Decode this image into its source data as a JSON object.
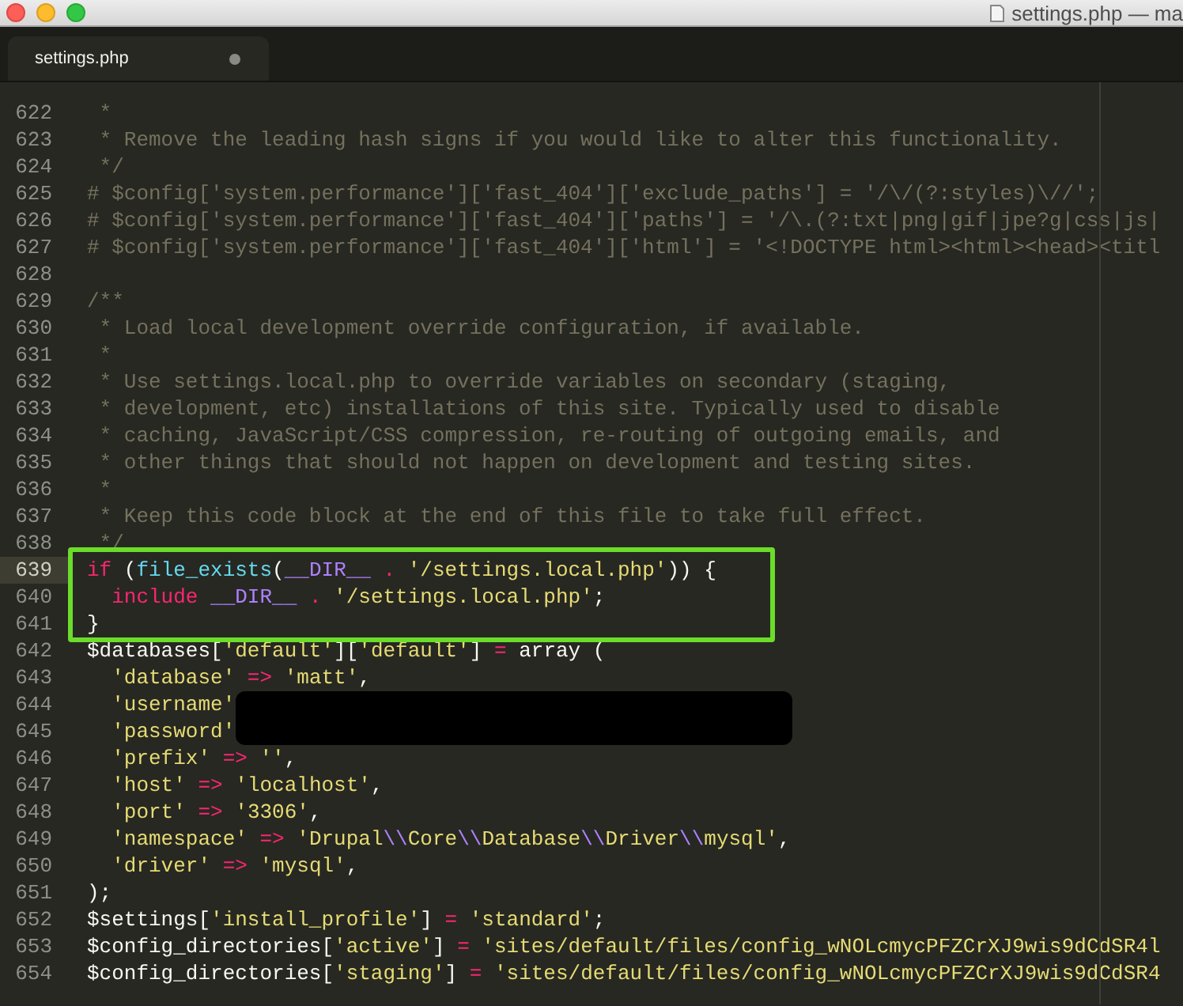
{
  "window": {
    "title": "settings.php — ma"
  },
  "tabs": [
    {
      "label": "settings.php",
      "selected": true,
      "modified": true
    }
  ],
  "lines": [
    {
      "number": "622",
      "current": false,
      "boxed": false,
      "redacted": false,
      "tokens": [
        {
          "kind": "comment",
          "text": " *"
        }
      ]
    },
    {
      "number": "623",
      "current": false,
      "boxed": false,
      "redacted": false,
      "tokens": [
        {
          "kind": "comment",
          "text": " * Remove the leading hash signs if you would like to alter this functionality."
        }
      ]
    },
    {
      "number": "624",
      "current": false,
      "boxed": false,
      "redacted": false,
      "tokens": [
        {
          "kind": "comment",
          "text": " */"
        }
      ]
    },
    {
      "number": "625",
      "current": false,
      "boxed": false,
      "redacted": false,
      "tokens": [
        {
          "kind": "comment",
          "text": "# $config['system.performance']['fast_404']['exclude_paths'] = '/\\/(?:styles)\\//';"
        }
      ]
    },
    {
      "number": "626",
      "current": false,
      "boxed": false,
      "redacted": false,
      "tokens": [
        {
          "kind": "comment",
          "text": "# $config['system.performance']['fast_404']['paths'] = '/\\.(?:txt|png|gif|jpe?g|css|js|"
        }
      ]
    },
    {
      "number": "627",
      "current": false,
      "boxed": false,
      "redacted": false,
      "tokens": [
        {
          "kind": "comment",
          "text": "# $config['system.performance']['fast_404']['html'] = '<!DOCTYPE html><html><head><titl"
        }
      ]
    },
    {
      "number": "628",
      "current": false,
      "boxed": false,
      "redacted": false
    },
    {
      "number": "629",
      "current": false,
      "boxed": false,
      "redacted": false,
      "tokens": [
        {
          "kind": "comment",
          "text": "/**"
        }
      ]
    },
    {
      "number": "630",
      "current": false,
      "boxed": false,
      "redacted": false,
      "tokens": [
        {
          "kind": "comment",
          "text": " * Load local development override configuration, if available."
        }
      ]
    },
    {
      "number": "631",
      "current": false,
      "boxed": false,
      "redacted": false,
      "tokens": [
        {
          "kind": "comment",
          "text": " *"
        }
      ]
    },
    {
      "number": "632",
      "current": false,
      "boxed": false,
      "redacted": false,
      "tokens": [
        {
          "kind": "comment",
          "text": " * Use settings.local.php to override variables on secondary (staging,"
        }
      ]
    },
    {
      "number": "633",
      "current": false,
      "boxed": false,
      "redacted": false,
      "tokens": [
        {
          "kind": "comment",
          "text": " * development, etc) installations of this site. Typically used to disable"
        }
      ]
    },
    {
      "number": "634",
      "current": false,
      "boxed": false,
      "redacted": false,
      "tokens": [
        {
          "kind": "comment",
          "text": " * caching, JavaScript/CSS compression, re-routing of outgoing emails, and"
        }
      ]
    },
    {
      "number": "635",
      "current": false,
      "boxed": false,
      "redacted": false,
      "tokens": [
        {
          "kind": "comment",
          "text": " * other things that should not happen on development and testing sites."
        }
      ]
    },
    {
      "number": "636",
      "current": false,
      "boxed": false,
      "redacted": false,
      "tokens": [
        {
          "kind": "comment",
          "text": " *"
        }
      ]
    },
    {
      "number": "637",
      "current": false,
      "boxed": false,
      "redacted": false,
      "tokens": [
        {
          "kind": "comment",
          "text": " * Keep this code block at the end of this file to take full effect."
        }
      ]
    },
    {
      "number": "638",
      "current": false,
      "boxed": false,
      "redacted": false,
      "tokens": [
        {
          "kind": "comment",
          "text": " */"
        }
      ]
    },
    {
      "number": "639",
      "current": true,
      "boxed": true,
      "redacted": false,
      "tokens": [
        {
          "kind": "keyword",
          "text": "if"
        },
        {
          "kind": "plain",
          "text": " ("
        },
        {
          "kind": "function",
          "text": "file_exists"
        },
        {
          "kind": "plain",
          "text": "("
        },
        {
          "kind": "constant",
          "text": "__DIR__"
        },
        {
          "kind": "operator",
          "text": " . "
        },
        {
          "kind": "string",
          "text": "'/settings.local.php'"
        },
        {
          "kind": "plain",
          "text": ")) {"
        }
      ]
    },
    {
      "number": "640",
      "current": false,
      "boxed": true,
      "redacted": false,
      "tokens": [
        {
          "kind": "keyword",
          "text": "  include"
        },
        {
          "kind": "constant",
          "text": " __DIR__"
        },
        {
          "kind": "operator",
          "text": " . "
        },
        {
          "kind": "string",
          "text": "'/settings.local.php'"
        },
        {
          "kind": "plain",
          "text": ";"
        }
      ]
    },
    {
      "number": "641",
      "current": false,
      "boxed": true,
      "redacted": false,
      "tokens": [
        {
          "kind": "plain",
          "text": "}"
        }
      ]
    },
    {
      "number": "642",
      "current": false,
      "boxed": false,
      "redacted": false,
      "tokens": [
        {
          "kind": "plain",
          "text": "$databases["
        },
        {
          "kind": "string",
          "text": "'default'"
        },
        {
          "kind": "plain",
          "text": "]["
        },
        {
          "kind": "string",
          "text": "'default'"
        },
        {
          "kind": "plain",
          "text": "] "
        },
        {
          "kind": "operator",
          "text": "="
        },
        {
          "kind": "plain",
          "text": " array ("
        }
      ]
    },
    {
      "number": "643",
      "current": false,
      "boxed": false,
      "redacted": false,
      "tokens": [
        {
          "kind": "string",
          "text": "  'database'"
        },
        {
          "kind": "operator",
          "text": " => "
        },
        {
          "kind": "string",
          "text": "'matt'"
        },
        {
          "kind": "plain",
          "text": ","
        }
      ]
    },
    {
      "number": "644",
      "current": false,
      "boxed": false,
      "redacted": true,
      "tokens": [
        {
          "kind": "string",
          "text": "  'username'"
        }
      ]
    },
    {
      "number": "645",
      "current": false,
      "boxed": false,
      "redacted": true,
      "tokens": [
        {
          "kind": "string",
          "text": "  'password'"
        }
      ]
    },
    {
      "number": "646",
      "current": false,
      "boxed": false,
      "redacted": false,
      "tokens": [
        {
          "kind": "string",
          "text": "  'prefix'"
        },
        {
          "kind": "operator",
          "text": " => "
        },
        {
          "kind": "string",
          "text": "''"
        },
        {
          "kind": "plain",
          "text": ","
        }
      ]
    },
    {
      "number": "647",
      "current": false,
      "boxed": false,
      "redacted": false,
      "tokens": [
        {
          "kind": "string",
          "text": "  'host'"
        },
        {
          "kind": "operator",
          "text": " => "
        },
        {
          "kind": "string",
          "text": "'localhost'"
        },
        {
          "kind": "plain",
          "text": ","
        }
      ]
    },
    {
      "number": "648",
      "current": false,
      "boxed": false,
      "redacted": false,
      "tokens": [
        {
          "kind": "string",
          "text": "  'port'"
        },
        {
          "kind": "operator",
          "text": " => "
        },
        {
          "kind": "string",
          "text": "'3306'"
        },
        {
          "kind": "plain",
          "text": ","
        }
      ]
    },
    {
      "number": "649",
      "current": false,
      "boxed": false,
      "redacted": false,
      "tokens": [
        {
          "kind": "string",
          "text": "  'namespace'"
        },
        {
          "kind": "operator",
          "text": " => "
        },
        {
          "kind": "string",
          "text": "'Drupal"
        },
        {
          "kind": "escape",
          "text": "\\\\"
        },
        {
          "kind": "string",
          "text": "Core"
        },
        {
          "kind": "escape",
          "text": "\\\\"
        },
        {
          "kind": "string",
          "text": "Database"
        },
        {
          "kind": "escape",
          "text": "\\\\"
        },
        {
          "kind": "string",
          "text": "Driver"
        },
        {
          "kind": "escape",
          "text": "\\\\"
        },
        {
          "kind": "string",
          "text": "mysql'"
        },
        {
          "kind": "plain",
          "text": ","
        }
      ]
    },
    {
      "number": "650",
      "current": false,
      "boxed": false,
      "redacted": false,
      "tokens": [
        {
          "kind": "string",
          "text": "  'driver'"
        },
        {
          "kind": "operator",
          "text": " => "
        },
        {
          "kind": "string",
          "text": "'mysql'"
        },
        {
          "kind": "plain",
          "text": ","
        }
      ]
    },
    {
      "number": "651",
      "current": false,
      "boxed": false,
      "redacted": false,
      "tokens": [
        {
          "kind": "plain",
          "text": ");"
        }
      ]
    },
    {
      "number": "652",
      "current": false,
      "boxed": false,
      "redacted": false,
      "tokens": [
        {
          "kind": "plain",
          "text": "$settings["
        },
        {
          "kind": "string",
          "text": "'install_profile'"
        },
        {
          "kind": "plain",
          "text": "]"
        },
        {
          "kind": "operator",
          "text": " = "
        },
        {
          "kind": "string",
          "text": "'standard'"
        },
        {
          "kind": "plain",
          "text": ";"
        }
      ]
    },
    {
      "number": "653",
      "current": false,
      "boxed": false,
      "redacted": false,
      "tokens": [
        {
          "kind": "plain",
          "text": "$config_directories["
        },
        {
          "kind": "string",
          "text": "'active'"
        },
        {
          "kind": "plain",
          "text": "] "
        },
        {
          "kind": "operator",
          "text": "="
        },
        {
          "kind": "string",
          "text": " 'sites/default/files/config_wNOLcmycPFZCrXJ9wis9dCdSR4l"
        }
      ]
    },
    {
      "number": "654",
      "current": false,
      "boxed": false,
      "redacted": false,
      "tokens": [
        {
          "kind": "plain",
          "text": "$config_directories["
        },
        {
          "kind": "string",
          "text": "'staging'"
        },
        {
          "kind": "plain",
          "text": "] "
        },
        {
          "kind": "operator",
          "text": "="
        },
        {
          "kind": "string",
          "text": " 'sites/default/files/config_wNOLcmycPFZCrXJ9wis9dCdSR4"
        }
      ]
    }
  ]
}
